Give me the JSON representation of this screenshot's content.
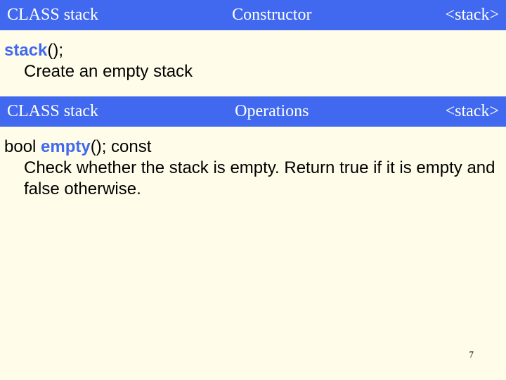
{
  "header1": {
    "left": "CLASS stack",
    "center": "Constructor",
    "right": "<stack>"
  },
  "constructor": {
    "name": "stack",
    "sig_suffix": "();",
    "desc": "Create an empty stack"
  },
  "header2": {
    "left": "CLASS stack",
    "center": "Operations",
    "right": "<stack>"
  },
  "op_empty": {
    "sig_prefix": "bool ",
    "name": "empty",
    "sig_suffix": "(); const",
    "desc": "Check whether the stack is empty. Return true if it is empty and false otherwise."
  },
  "page_number": "7"
}
